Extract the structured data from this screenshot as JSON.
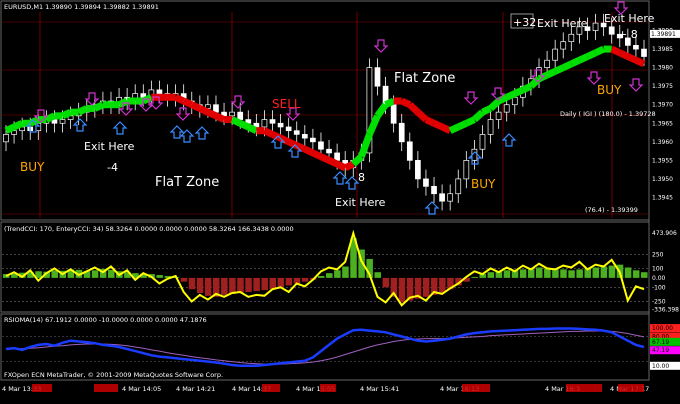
{
  "window": {
    "symbol_header": "EURUSD,M1  1.39890  1.39894  1.39882  1.39891",
    "footer": "FXOpen ECN MetaTrader, © 2001-2009 MetaQuotes Software Corp."
  },
  "colors": {
    "background": "#000000",
    "candle": "#ffffff",
    "trend_up": "#00e000",
    "trend_down": "#e00000",
    "cci_yellow": "#ffff00",
    "rsi_blue": "#1a3cff",
    "rsi_purple": "#a060c0",
    "arrow_up": "#3a8cff",
    "arrow_down": "#cc33cc",
    "buy_text": "#ffa500",
    "sell_text": "#ff2020",
    "grid_red": "#8b0000"
  },
  "annotations": {
    "buy_1": "BUY",
    "buy_2": "BUY",
    "buy_3": "BUY",
    "sell": "SELL",
    "exit_1": "Exit Here",
    "exit_2": "Exit Here",
    "exit_3": "Exit Here",
    "exit_4": "Exit Here",
    "minus4": "-4",
    "plus32": "+32",
    "plus8": "+ 8",
    "eight": "8",
    "flat_zone_1": "FlaT Zone",
    "flat_zone_2": "Flat Zone"
  },
  "indicators": {
    "daily_label": "Daily ( IGI ) (180.0) - 1.39728",
    "range_label": "(76.4) - 1.39399",
    "cci_header": "(TrendCCI: 170, EnteryCCI: 34)  58.3264  0.0000  0.0000  0.0000  58.3264  166.3438  0.0000",
    "rsi_header": "RSIOMA(14)  67.1912  0.0000  -10.0000  0.0000  0.0000  47.1876"
  },
  "chart_data": [
    {
      "type": "candlestick",
      "title": "EURUSD,M1",
      "price_scale": [
        "1.3990",
        "1.3985",
        "1.3980",
        "1.3975",
        "1.3970",
        "1.3965",
        "1.3960",
        "1.3955",
        "1.3950",
        "1.3945"
      ],
      "price_highlight": "1.39891",
      "ylim": [
        1.394,
        1.3995
      ],
      "close": [
        1.3962,
        1.3963,
        1.3964,
        1.3963,
        1.3965,
        1.3966,
        1.3965,
        1.3966,
        1.3967,
        1.3968,
        1.3969,
        1.397,
        1.3971,
        1.397,
        1.3972,
        1.3971,
        1.3973,
        1.3972,
        1.3974,
        1.3973,
        1.3972,
        1.3973,
        1.3971,
        1.397,
        1.3969,
        1.397,
        1.3968,
        1.3967,
        1.3968,
        1.3966,
        1.3965,
        1.3964,
        1.3966,
        1.3965,
        1.3964,
        1.3963,
        1.3962,
        1.3961,
        1.396,
        1.3958,
        1.3957,
        1.3955,
        1.3953,
        1.3955,
        1.3957,
        1.398,
        1.3975,
        1.397,
        1.3965,
        1.396,
        1.3955,
        1.395,
        1.3948,
        1.3946,
        1.3944,
        1.3946,
        1.395,
        1.3955,
        1.3958,
        1.3962,
        1.3966,
        1.3968,
        1.397,
        1.3972,
        1.3975,
        1.3977,
        1.398,
        1.3982,
        1.3985,
        1.3987,
        1.3989,
        1.3991,
        1.399,
        1.3992,
        1.3991,
        1.3989,
        1.3988,
        1.3986,
        1.3985,
        1.3983
      ],
      "moving_average": [
        1.3963,
        1.3964,
        1.3965,
        1.3965,
        1.3966,
        1.3966,
        1.3967,
        1.3967,
        1.3968,
        1.3968,
        1.3969,
        1.3969,
        1.397,
        1.397,
        1.397,
        1.3971,
        1.3971,
        1.3971,
        1.3972,
        1.3972,
        1.3972,
        1.3972,
        1.3971,
        1.397,
        1.3969,
        1.3968,
        1.3967,
        1.3966,
        1.3966,
        1.3965,
        1.3964,
        1.3963,
        1.3963,
        1.3962,
        1.3961,
        1.396,
        1.3959,
        1.3958,
        1.3957,
        1.3956,
        1.3955,
        1.3954,
        1.3953,
        1.3954,
        1.3956,
        1.3962,
        1.3967,
        1.397,
        1.3971,
        1.3971,
        1.397,
        1.3968,
        1.3966,
        1.3965,
        1.3964,
        1.3963,
        1.3964,
        1.3965,
        1.3966,
        1.3968,
        1.3969,
        1.3971,
        1.3972,
        1.3973,
        1.3974,
        1.3975,
        1.3977,
        1.3978,
        1.3979,
        1.398,
        1.3981,
        1.3982,
        1.3983,
        1.3984,
        1.3985,
        1.3985,
        1.3984,
        1.3983,
        1.3982,
        1.3981
      ],
      "ma_trend": [
        "up",
        "up",
        "up",
        "up",
        "up",
        "up",
        "up",
        "up",
        "up",
        "up",
        "up",
        "up",
        "up",
        "up",
        "up",
        "up",
        "up",
        "up",
        "down",
        "down",
        "down",
        "down",
        "down",
        "down",
        "down",
        "down",
        "down",
        "down",
        "up",
        "up",
        "up",
        "down",
        "down",
        "down",
        "down",
        "down",
        "down",
        "down",
        "down",
        "down",
        "down",
        "down",
        "down",
        "up",
        "up",
        "up",
        "up",
        "up",
        "down",
        "down",
        "down",
        "down",
        "down",
        "down",
        "down",
        "up",
        "up",
        "up",
        "up",
        "up",
        "up",
        "up",
        "up",
        "up",
        "up",
        "up",
        "up",
        "up",
        "up",
        "up",
        "up",
        "up",
        "up",
        "up",
        "up",
        "down",
        "down",
        "down",
        "down",
        "down"
      ]
    },
    {
      "type": "histogram",
      "title": "TrendCCI",
      "scale": [
        "473.906",
        "250",
        "100",
        "0.00",
        "-100",
        "-250",
        "-336.398"
      ],
      "ylim": [
        -340,
        475
      ],
      "values": [
        40,
        45,
        55,
        60,
        70,
        65,
        80,
        75,
        90,
        85,
        70,
        80,
        95,
        85,
        70,
        60,
        50,
        45,
        40,
        30,
        20,
        10,
        -40,
        -120,
        -160,
        -190,
        -200,
        -180,
        -170,
        -160,
        -150,
        -140,
        -130,
        -120,
        -100,
        -80,
        -60,
        -40,
        -20,
        20,
        50,
        80,
        120,
        420,
        300,
        200,
        60,
        -100,
        -200,
        -260,
        -240,
        -220,
        -200,
        -180,
        -160,
        -120,
        -80,
        -40,
        10,
        40,
        60,
        70,
        80,
        85,
        90,
        100,
        110,
        100,
        95,
        90,
        80,
        90,
        100,
        110,
        120,
        130,
        140,
        110,
        80,
        60
      ],
      "cci_line": [
        20,
        60,
        10,
        80,
        -30,
        50,
        100,
        40,
        90,
        30,
        70,
        110,
        60,
        120,
        30,
        80,
        -20,
        50,
        10,
        -60,
        -10,
        20,
        -150,
        -250,
        -180,
        -230,
        -170,
        -200,
        -160,
        -150,
        -200,
        -180,
        -190,
        -120,
        -100,
        -150,
        -60,
        -90,
        -20,
        70,
        110,
        90,
        170,
        473,
        180,
        40,
        -200,
        -260,
        -160,
        -290,
        -210,
        -190,
        -240,
        -150,
        -170,
        -110,
        -60,
        10,
        70,
        40,
        100,
        60,
        110,
        70,
        130,
        90,
        150,
        100,
        90,
        130,
        110,
        170,
        90,
        140,
        120,
        190,
        60,
        -240,
        -90,
        -120
      ]
    },
    {
      "type": "line",
      "title": "RSIOMA(14)",
      "scale": [
        "100.00",
        "80.00",
        "67.19",
        "47.19",
        "10.00"
      ],
      "ylim": [
        0,
        105
      ],
      "rsi": [
        50,
        52,
        48,
        55,
        60,
        62,
        58,
        65,
        70,
        68,
        66,
        64,
        60,
        58,
        55,
        50,
        45,
        40,
        35,
        32,
        30,
        28,
        26,
        24,
        22,
        20,
        18,
        15,
        12,
        10,
        10,
        10,
        12,
        14,
        16,
        18,
        20,
        22,
        30,
        45,
        60,
        75,
        85,
        95,
        96,
        94,
        92,
        90,
        85,
        80,
        75,
        70,
        68,
        70,
        72,
        75,
        80,
        85,
        88,
        90,
        92,
        93,
        94,
        95,
        96,
        97,
        98,
        98,
        99,
        99,
        99,
        98,
        97,
        96,
        94,
        90,
        80,
        70,
        60,
        55
      ],
      "signal": [
        50,
        51,
        51,
        52,
        53,
        55,
        57,
        58,
        60,
        61,
        62,
        62,
        62,
        61,
        60,
        58,
        55,
        52,
        48,
        45,
        41,
        38,
        35,
        32,
        29,
        27,
        24,
        22,
        20,
        18,
        16,
        15,
        14,
        14,
        14,
        15,
        16,
        17,
        19,
        22,
        26,
        31,
        37,
        43,
        49,
        55,
        60,
        64,
        68,
        71,
        73,
        74,
        75,
        75,
        75,
        76,
        77,
        78,
        79,
        80,
        82,
        83,
        84,
        85,
        86,
        87,
        88,
        89,
        90,
        91,
        92,
        92,
        93,
        93,
        93,
        92,
        90,
        87,
        83,
        79
      ]
    }
  ],
  "time_axis": {
    "labels": [
      "4 Mar 13:33",
      "4 Mar 14:05",
      "4 Mar 14:21",
      "4 Mar 14:37",
      "4 Mar 15:05",
      "4 Mar 15:41",
      "4 Mar 16:13",
      "4 Mar 16:3",
      "4 Mar 17:17"
    ]
  }
}
